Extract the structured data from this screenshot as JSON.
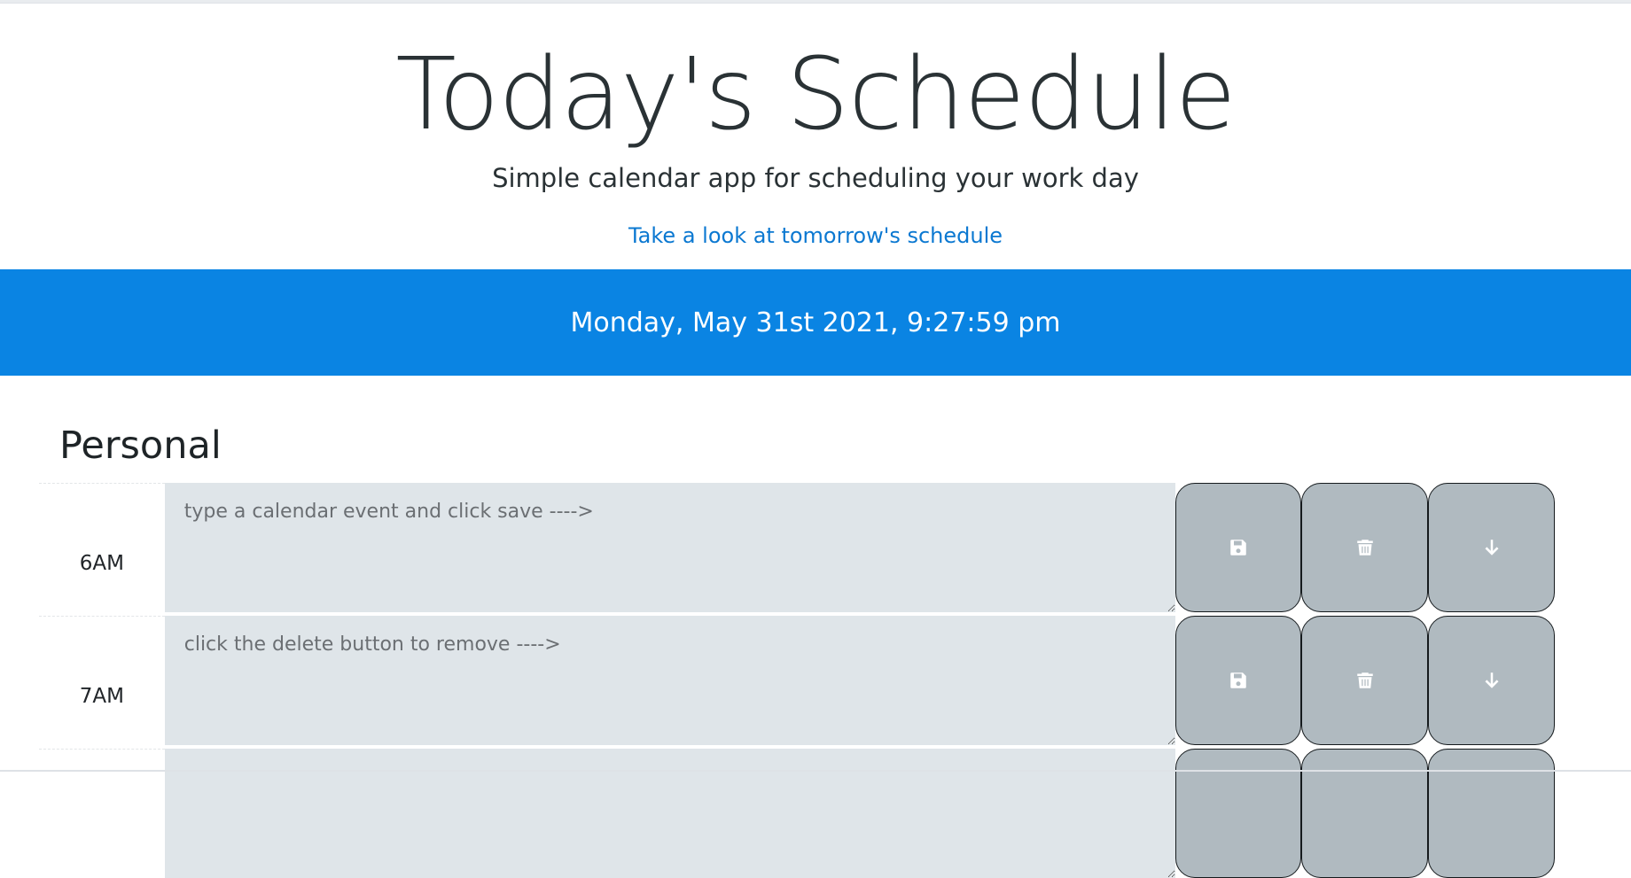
{
  "header": {
    "title": "Today's Schedule",
    "subtitle": "Simple calendar app for scheduling your work day",
    "tomorrow_link": "Take a look at tomorrow's schedule"
  },
  "date_bar": {
    "text": "Monday, May 31st 2021, 9:27:59 pm"
  },
  "section": {
    "title": "Personal"
  },
  "rows": [
    {
      "hour": "6AM",
      "placeholder": "type a calendar event and click save ---->"
    },
    {
      "hour": "7AM",
      "placeholder": "click the delete button to remove ---->"
    },
    {
      "hour": "",
      "placeholder": ""
    }
  ],
  "icons": {
    "save": "save-icon",
    "delete": "trash-icon",
    "move": "arrow-down-icon"
  },
  "colors": {
    "date_bar": "#0a84e3",
    "link": "#0b78d1",
    "textarea_bg": "#dfe5e9",
    "button_bg": "#b0bac0"
  }
}
